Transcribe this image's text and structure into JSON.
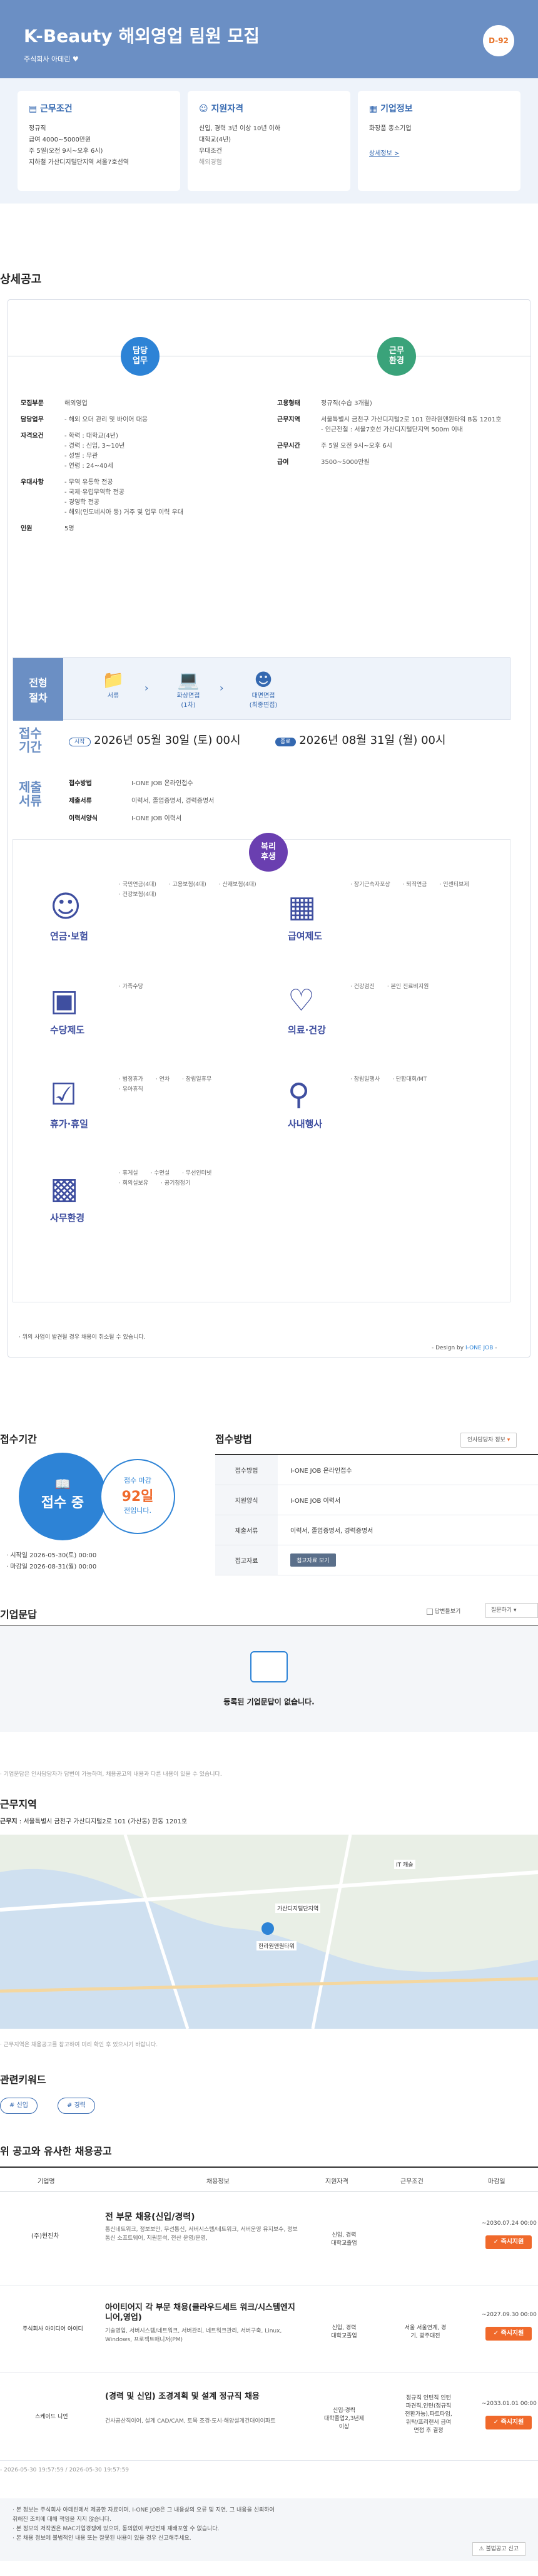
{
  "header": {
    "title": "K-Beauty 해외영업 팀원 모집",
    "company": "주식회사 아데린",
    "dday": "D-92"
  },
  "summary": {
    "work": {
      "title": "근무조건",
      "lines": [
        "정규직",
        "급여 4000~5000만원",
        "주 5일(오전 9시~오후 6시)",
        "지하철 가산디지털단지역 서울7호선역"
      ]
    },
    "qual": {
      "title": "지원자격",
      "lines": [
        "신입, 경력 3년 이상 10년 이하",
        "대학교(4년)",
        "우대조건",
        "해외경험"
      ]
    },
    "company": {
      "title": "기업정보",
      "lines": [
        "화장품 종소기업"
      ],
      "link": "상세정보 >"
    }
  },
  "detail_title": "상세공고",
  "detail": {
    "duty_pill": "담당\n업무",
    "env_pill": "근무\n환경",
    "left": [
      {
        "k": "모집부문",
        "v": "해외영업"
      },
      {
        "k": "담당업무",
        "v": "- 해외 오더 관리 및 바이어 대응"
      },
      {
        "k": "자격요건",
        "v": "- 학력 : 대학교(4년)\n- 경력 : 신입, 3~10년\n- 성별 : 무관\n- 연령 : 24~40세"
      },
      {
        "k": "우대사항",
        "v": "- 무역 유통학 전공\n- 국제·유럽무역학 전공\n- 경영학 전공\n- 해외(인도네시아 등) 거주 및 업무 이력 우대"
      },
      {
        "k": "인원",
        "v": "5명"
      }
    ],
    "right": [
      {
        "k": "고용형태",
        "v": "정규직(수습 3개월)"
      },
      {
        "k": "근무지역",
        "v": "서울특별시 금천구 가산디지털2로 101 한라원앤원타워 B동 1201호\n- 인근전철 : 서울7호선 가산디지털단지역 500m 이내"
      },
      {
        "k": "근무시간",
        "v": "주 5일 오전 9시~오후 6시"
      },
      {
        "k": "급여",
        "v": "3500~5000만원"
      }
    ],
    "process_label": "전형\n절차",
    "steps": [
      "서류",
      "화상면접\n(1차)",
      "대면면접\n(최종면접)"
    ],
    "period_label": "접수\n기간",
    "start_tag": "시작",
    "start": "2026년 05월 30일 (토) 00시",
    "end_tag": "종료",
    "end": "2026년 08월 31일 (월) 00시",
    "submit_label": "제출\n서류",
    "submit": [
      {
        "k": "접수방법",
        "v": "I-ONE JOB 온라인접수"
      },
      {
        "k": "제출서류",
        "v": "이력서, 졸업증명서, 경력증명서"
      },
      {
        "k": "이력서양식",
        "v": "I-ONE JOB 이력서"
      }
    ],
    "benefit_pill": "복리\n후생",
    "benefits": [
      {
        "title": "연금·보험",
        "items": [
          "· 국민연금(4대)",
          "· 고용보험(4대)",
          "· 산재보험(4대)",
          "· 건강보험(4대)"
        ]
      },
      {
        "title": "급여제도",
        "items": [
          "· 장기근속자포상",
          "· 퇴직연금",
          "· 인센티브제"
        ]
      },
      {
        "title": "수당제도",
        "items": [
          "· 가족수당"
        ]
      },
      {
        "title": "의료·건강",
        "items": [
          "· 건강검진",
          "· 본인 진료비지원"
        ]
      },
      {
        "title": "휴가·휴일",
        "items": [
          "· 법정휴가",
          "· 연차",
          "· 창립일휴무",
          "· 유아휴직"
        ]
      },
      {
        "title": "사내행사",
        "items": [
          "· 창립일행사",
          "· 단합대회/MT"
        ]
      },
      {
        "title": "사무환경",
        "items": [
          "· 휴게실",
          "· 수면실",
          "· 무선인터넷",
          "· 회의실보유",
          "· 공기청정기"
        ]
      }
    ],
    "note": "· 위의 사업이 발견될 경우 채용이 취소될 수 있습니다.",
    "design": "- Design by ",
    "design_brand": "I-ONE JOB",
    "design_end": " -"
  },
  "apply_period": {
    "title": "접수기간",
    "status": "접수 중",
    "remain_label": "접수 마감",
    "remain_days": "92일",
    "remain_suffix": "전입니다.",
    "start": "· 시작일 2026-05-30(토) 00:00",
    "end": "· 마감일 2026-08-31(월) 00:00"
  },
  "apply_method": {
    "title": "접수방법",
    "info_btn": "인사담당자 정보",
    "rows": [
      {
        "k": "접수방법",
        "v": "I-ONE JOB 온라인접수"
      },
      {
        "k": "지원양식",
        "v": "I-ONE JOB 이력서"
      },
      {
        "k": "제출서류",
        "v": "이력서, 졸업증명서, 경력증명서"
      },
      {
        "k": "접고자료",
        "v": "첨고자료 보기"
      }
    ]
  },
  "qa": {
    "title": "기업문답",
    "checkbox": "답변들보기",
    "select": "질문하기",
    "empty": "등록된 기업문답이 없습니다.",
    "note": "· 기업문답은 인사담당자가 답변이 가능하며, 채용공고의 내용과 다른 내용이 있을 수 있습니다."
  },
  "location": {
    "title": "근무지역",
    "addr_label": "근무지",
    "addr": "서울특별시 금천구 가산디지털2로 101 (가산동) 한동 1201호",
    "note": "· 근무지역은 채용공고를 참고하여 미리 확인 후 있으시기 바랍니다.",
    "map_labels": [
      "가산디지털단지역",
      "한라원앤원타워",
      "IT 캐슬"
    ]
  },
  "keywords": {
    "title": "관련키워드",
    "tags": [
      "# 신입",
      "# 경력"
    ]
  },
  "similar": {
    "title": "위 공고와 유사한 채용공고",
    "headers": [
      "기업명",
      "채용정보",
      "지원자격",
      "근무조건",
      "마감일"
    ],
    "rows": [
      {
        "company": "(주)현진차",
        "title": "전 부문 채용(신입/경력)",
        "desc": "통신네트워크, 정보보안, 무선통신, 서버시스템/네트워크, 서버운영 유지보수, 정보통신 소프트웨어, 지원분석, 전산 운영/운영,",
        "qual": "신입, 경력\n대학교졸업",
        "cond": "",
        "deadline": "~2030.07.24 00:00",
        "btn": "즉시지원"
      },
      {
        "company": "주식회사 아이디어 아이디",
        "title": "아이티어지 각 부문 채용(클라우드세트 워크/시스템엔지니어,영업)",
        "desc": "기술영업, 서버시스템/네트워크, 서버관리, 네트워크관리, 서버구축, Linux, Windows, 프로젝트매니저(PM)",
        "qual": "신입, 경력\n대학교졸업",
        "cond": "서울 서울연계, 경\n기, 광주대전",
        "deadline": "~2027.09.30 00:00",
        "btn": "즉시지원"
      },
      {
        "company": "스케이드 니언",
        "title": "(경력 및 신입) 조경계획 및 설계 정규직 채용",
        "desc": "건사공산직이어, 설계 CAD/CAM, 토목 조경·도시·해양설계건대이이파트",
        "qual": "신입·경력\n대학졸업2,3년제\n이상",
        "cond": "정규직 인턴직 인턴\n파견직,인턴(정규직\n전환가능),파트타임,\n위탁/프리랜서 급여\n면접 후 결정",
        "deadline": "~2033.01.01 00:00",
        "btn": "즉시지원"
      }
    ]
  },
  "footer": {
    "dates": "- 2026-05-30 19:57:59 / 2026-05-30 19:57:59",
    "notes": [
      "· 본 정보는 주식회사 아데린에서 제공한 자료이며, I-ONE JOB은 그 내용상의 오류 및 지연, 그 내용을 신뢰하여",
      "  취해진 조치에 대해 책임을 지지 않습니다.",
      "· 본 정보의 저작권은 MAC기업경쟁에 있으며, 동의없이 무단전재 재배포할 수 없습니다.",
      "· 본 채용 정보에 불법적인 내용 또는 잘못된 내용이 있을 경우 신고해주세요."
    ],
    "report": "불법공고 신고"
  },
  "colors": {
    "primary": "#6b8fc4",
    "accent": "#f0692b",
    "green": "#3aa37a",
    "blue": "#2d83d6"
  }
}
